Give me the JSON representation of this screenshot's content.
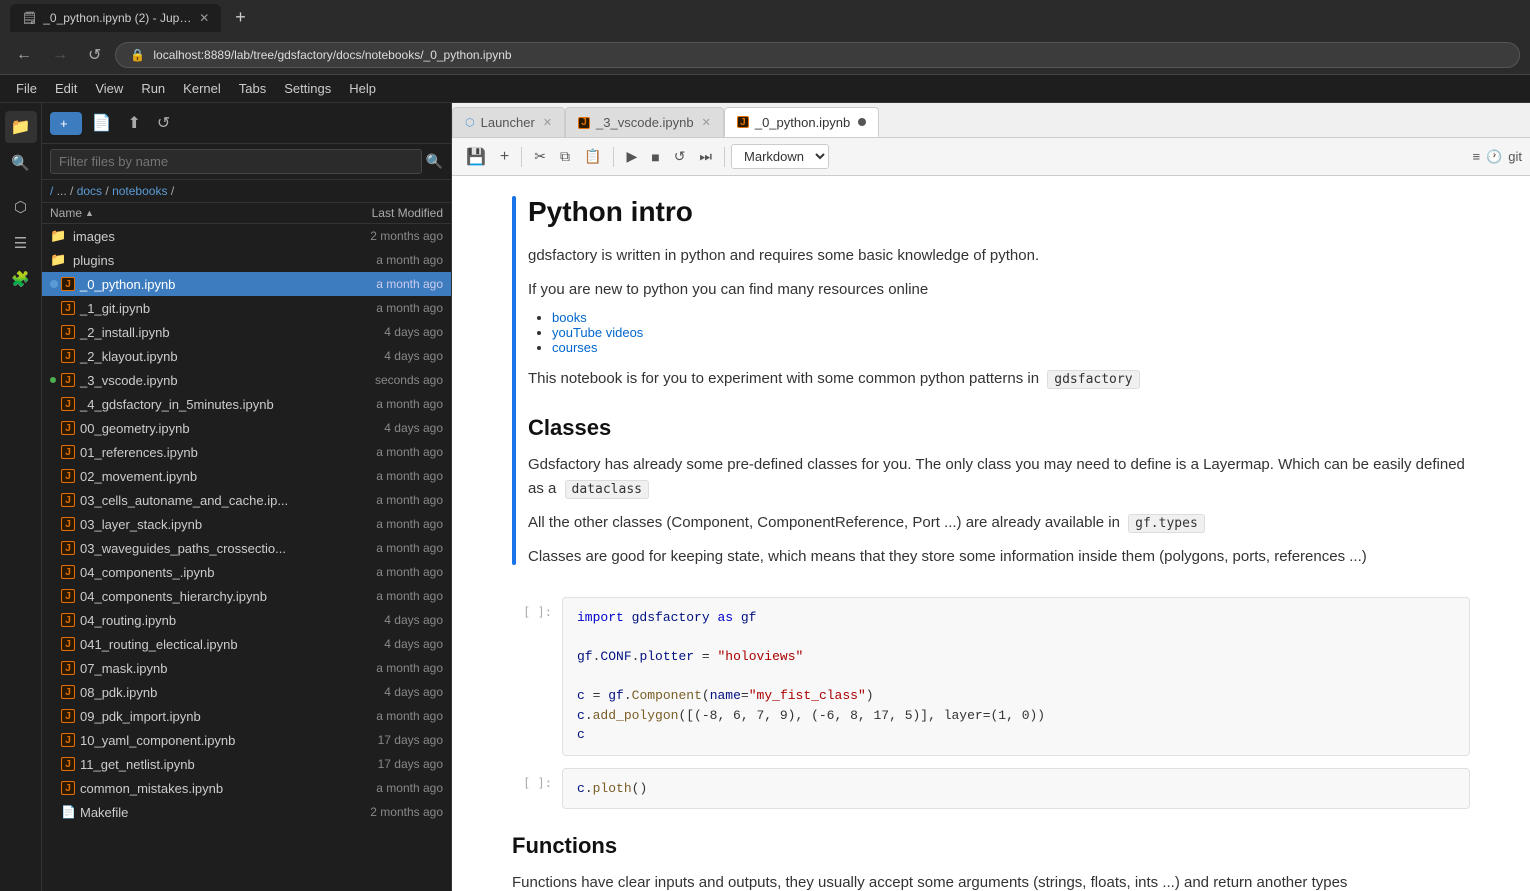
{
  "browser": {
    "tabs": [
      {
        "id": "tab1",
        "title": "_0_python.ipynb (2) - Jupyt...",
        "active": true,
        "favicon": "🔵"
      }
    ],
    "address": "localhost:8889/lab/tree/gdsfactory/docs/notebooks/_0_python.ipynb",
    "new_tab_label": "+"
  },
  "menu": {
    "items": [
      "File",
      "Edit",
      "View",
      "Run",
      "Kernel",
      "Tabs",
      "Settings",
      "Help"
    ]
  },
  "sidebar_icons": [
    "files",
    "search",
    "extensions",
    "commands",
    "puzzle"
  ],
  "file_browser": {
    "search_placeholder": "Filter files by name",
    "breadcrumb": "/ ... / docs / notebooks /",
    "columns": {
      "name": "Name",
      "modified": "Last Modified"
    },
    "files": [
      {
        "type": "folder",
        "name": "images",
        "modified": "2 months ago"
      },
      {
        "type": "folder",
        "name": "plugins",
        "modified": "a month ago"
      },
      {
        "type": "notebook",
        "name": "_0_python.ipynb",
        "modified": "a month ago",
        "selected": true,
        "open": true
      },
      {
        "type": "notebook",
        "name": "_1_git.ipynb",
        "modified": "a month ago"
      },
      {
        "type": "notebook",
        "name": "_2_install.ipynb",
        "modified": "4 days ago"
      },
      {
        "type": "notebook",
        "name": "_2_klayout.ipynb",
        "modified": "4 days ago"
      },
      {
        "type": "notebook",
        "name": "_3_vscode.ipynb",
        "modified": "seconds ago",
        "dot": true
      },
      {
        "type": "notebook",
        "name": "_4_gdsfactory_in_5minutes.ipynb",
        "modified": "a month ago"
      },
      {
        "type": "notebook",
        "name": "00_geometry.ipynb",
        "modified": "4 days ago"
      },
      {
        "type": "notebook",
        "name": "01_references.ipynb",
        "modified": "a month ago"
      },
      {
        "type": "notebook",
        "name": "02_movement.ipynb",
        "modified": "a month ago"
      },
      {
        "type": "notebook",
        "name": "03_cells_autoname_and_cache.ip...",
        "modified": "a month ago"
      },
      {
        "type": "notebook",
        "name": "03_layer_stack.ipynb",
        "modified": "a month ago"
      },
      {
        "type": "notebook",
        "name": "03_waveguides_paths_crossectio...",
        "modified": "a month ago"
      },
      {
        "type": "notebook",
        "name": "04_components_.ipynb",
        "modified": "a month ago"
      },
      {
        "type": "notebook",
        "name": "04_components_hierarchy.ipynb",
        "modified": "a month ago"
      },
      {
        "type": "notebook",
        "name": "04_routing.ipynb",
        "modified": "4 days ago"
      },
      {
        "type": "notebook",
        "name": "041_routing_electical.ipynb",
        "modified": "4 days ago"
      },
      {
        "type": "notebook",
        "name": "07_mask.ipynb",
        "modified": "a month ago"
      },
      {
        "type": "notebook",
        "name": "08_pdk.ipynb",
        "modified": "4 days ago"
      },
      {
        "type": "notebook",
        "name": "09_pdk_import.ipynb",
        "modified": "a month ago"
      },
      {
        "type": "notebook",
        "name": "10_yaml_component.ipynb",
        "modified": "17 days ago"
      },
      {
        "type": "notebook",
        "name": "11_get_netlist.ipynb",
        "modified": "17 days ago"
      },
      {
        "type": "notebook",
        "name": "common_mistakes.ipynb",
        "modified": "a month ago"
      },
      {
        "type": "file",
        "name": "Makefile",
        "modified": "2 months ago"
      }
    ]
  },
  "notebook_tabs": [
    {
      "id": "launcher",
      "label": "Launcher",
      "type": "launcher",
      "closeable": true
    },
    {
      "id": "vscode",
      "label": "_3_vscode.ipynb",
      "type": "notebook",
      "closeable": true
    },
    {
      "id": "python",
      "label": "_0_python.ipynb",
      "type": "notebook",
      "closeable": true,
      "active": true,
      "unsaved": true
    }
  ],
  "toolbar": {
    "save": "💾",
    "add_cell": "+",
    "cut": "✂",
    "copy": "⧉",
    "paste": "📋",
    "run": "▶",
    "stop": "■",
    "restart": "↺",
    "fast_forward": "⏭",
    "cell_type": "Markdown",
    "format_icon": "≡",
    "time_icon": "🕐",
    "git_label": "git"
  },
  "content": {
    "title": "Python intro",
    "intro_text": "gdsfactory is written in python and requires some basic knowledge of python.",
    "new_to_python": "If you are new to python you can find many resources online",
    "links": [
      "books",
      "youTube videos",
      "courses"
    ],
    "notebook_info": "This notebook is for you to experiment with some common python patterns in",
    "notebook_code_ref": "gdsfactory",
    "classes_title": "Classes",
    "classes_intro": "Gdsfactory has already some pre-defined classes for you. The only class you may need to define is a Layermap. Which can be easily defined as a",
    "classes_code1": "dataclass",
    "classes_all": "All the other classes (Component, ComponentReference, Port ...) are already available in",
    "classes_code2": "gf.types",
    "classes_state": "Classes are good for keeping state, which means that they store some information inside them (polygons, ports, references ...)",
    "functions_title": "Functions",
    "functions_text": "Functions have clear inputs and outputs, they usually accept some arguments (strings, floats, ints ...) and return another types",
    "code_cells": [
      {
        "number": "[ ]:",
        "lines": [
          {
            "type": "code",
            "content": "import gdsfactory as gf"
          },
          {
            "type": "blank"
          },
          {
            "type": "code",
            "content": "gf.CONF.plotter = \"holoviews\""
          },
          {
            "type": "blank"
          },
          {
            "type": "code",
            "content": "c = gf.Component(name=\"my_fist_class\")"
          },
          {
            "type": "code",
            "content": "c.add_polygon([(-8, 6, 7, 9), (-6, 8, 17, 5)], layer=(1, 0))"
          },
          {
            "type": "code",
            "content": "c"
          }
        ]
      },
      {
        "number": "[ ]:",
        "lines": [
          {
            "type": "code",
            "content": "c.ploth()"
          }
        ]
      }
    ]
  }
}
